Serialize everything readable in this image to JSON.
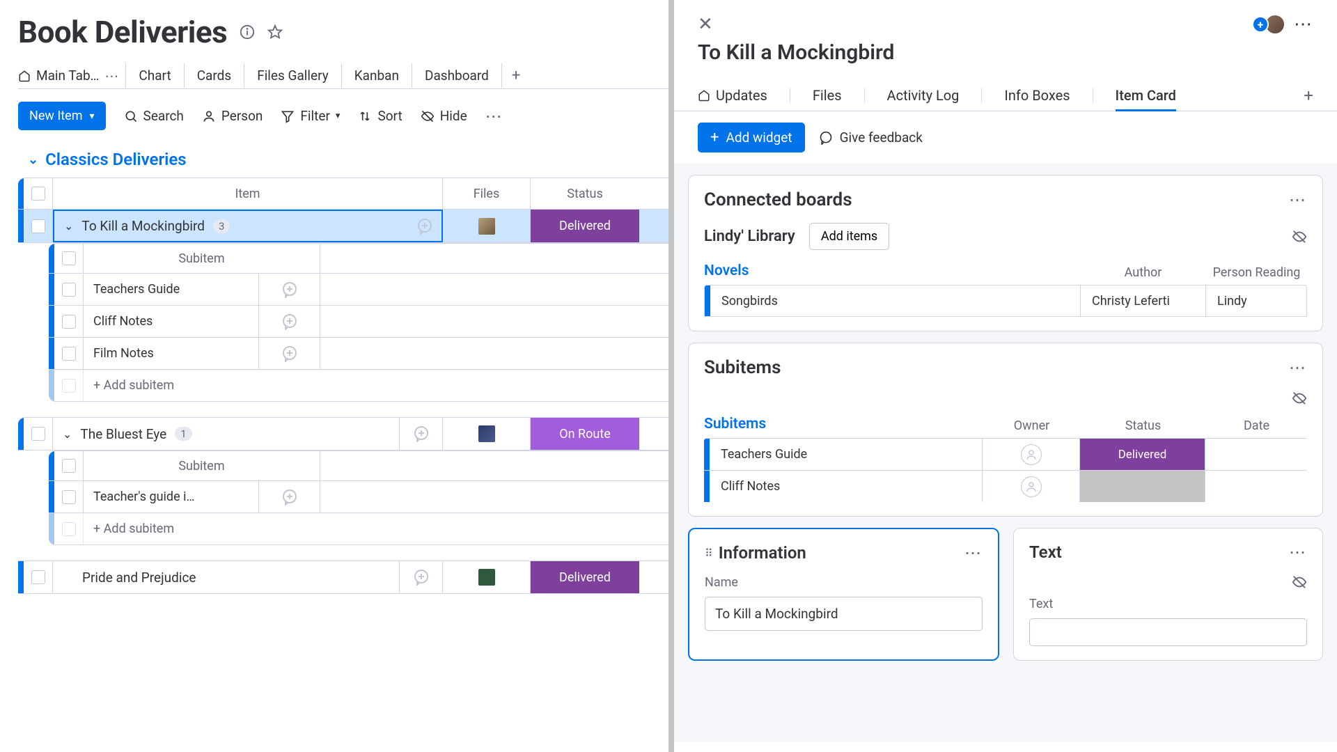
{
  "board": {
    "title": "Book Deliveries",
    "views": [
      "Main Tab…",
      "Chart",
      "Cards",
      "Files Gallery",
      "Kanban",
      "Dashboard"
    ],
    "toolbar": {
      "new_item": "New Item",
      "search": "Search",
      "person": "Person",
      "filter": "Filter",
      "sort": "Sort",
      "hide": "Hide"
    },
    "group": {
      "name": "Classics Deliveries",
      "columns": {
        "item": "Item",
        "files": "Files",
        "status": "Status"
      },
      "subcolumn": "Subitem",
      "add_subitem": "+ Add subitem",
      "items": [
        {
          "name": "To Kill a Mockingbird",
          "count": "3",
          "status": "Delivered",
          "status_class": "status-delivered",
          "thumb": "file-thumb",
          "selected": true,
          "subitems": [
            "Teachers Guide",
            "Cliff Notes",
            "Film Notes"
          ]
        },
        {
          "name": "The Bluest Eye",
          "count": "1",
          "status": "On Route",
          "status_class": "status-onroute",
          "thumb": "file-thumb blue",
          "subitems": [
            "Teacher's guide i…"
          ]
        },
        {
          "name": "Pride and Prejudice",
          "status": "Delivered",
          "status_class": "status-delivered",
          "thumb": "file-thumb green"
        }
      ]
    }
  },
  "panel": {
    "title": "To Kill a Mockingbird",
    "tabs": [
      "Updates",
      "Files",
      "Activity Log",
      "Info Boxes",
      "Item Card"
    ],
    "active_tab": "Item Card",
    "add_widget": "Add widget",
    "give_feedback": "Give feedback",
    "connected_boards": {
      "title": "Connected boards",
      "library": "Lindy' Library",
      "add_items": "Add items",
      "group": "Novels",
      "columns": [
        "Author",
        "Person Reading"
      ],
      "row": {
        "name": "Songbirds",
        "author": "Christy Leferti",
        "reader": "Lindy"
      }
    },
    "subitems_widget": {
      "title": "Subitems",
      "group": "Subitems",
      "columns": [
        "Owner",
        "Status",
        "Date"
      ],
      "rows": [
        {
          "name": "Teachers Guide",
          "status": "Delivered",
          "status_class": "status-delivered"
        },
        {
          "name": "Cliff Notes",
          "status": "",
          "status_class": "status-blank"
        }
      ]
    },
    "info_widget": {
      "title": "Information",
      "name_label": "Name",
      "name_value": "To Kill a Mockingbird"
    },
    "text_widget": {
      "title": "Text",
      "label": "Text"
    }
  }
}
